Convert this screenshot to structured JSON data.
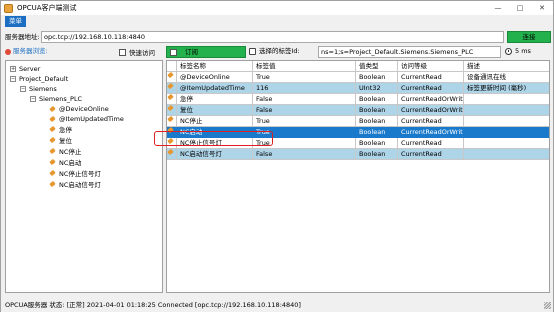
{
  "window": {
    "title": "OPCUA客户端测试",
    "minimize": "—",
    "maximize": "□",
    "close": "✕"
  },
  "menu": {
    "items": [
      "菜单"
    ]
  },
  "address": {
    "label": "服务器地址:",
    "value": "opc.tcp://192.168.10.118:4840",
    "connect_label": "连接"
  },
  "filter": {
    "label": "服务器浏览:",
    "quick_access": "快速访问",
    "subscribe_label": "订阅",
    "selected_tag_label": "选择的标签Id:",
    "selected_tag_value": "ns=1;s=Project_Default.Siemens.Siemens_PLC",
    "interval": "5 ms"
  },
  "tree": {
    "nodes": [
      {
        "label": "Server",
        "expander": "+"
      },
      {
        "label": "Project_Default",
        "expander": "−"
      },
      {
        "label": "Siemens",
        "expander": "−"
      },
      {
        "label": "Siemens_PLC",
        "expander": "−"
      },
      {
        "label": "@DeviceOnline"
      },
      {
        "label": "@ItemUpdatedTime"
      },
      {
        "label": "急停"
      },
      {
        "label": "复位"
      },
      {
        "label": "NC停止"
      },
      {
        "label": "NC启动"
      },
      {
        "label": "NC停止信号灯"
      },
      {
        "label": "NC启动信号灯"
      }
    ]
  },
  "grid": {
    "headers": [
      "标签名称",
      "标签值",
      "值类型",
      "访问等级",
      "描述"
    ],
    "rows": [
      [
        "@DeviceOnline",
        "True",
        "Boolean",
        "CurrentRead",
        "设备通讯在线"
      ],
      [
        "@ItemUpdatedTime",
        "116",
        "UInt32",
        "CurrentRead",
        "标签更新时间 (毫秒)"
      ],
      [
        "急停",
        "False",
        "Boolean",
        "CurrentReadOrWrite",
        ""
      ],
      [
        "复位",
        "False",
        "Boolean",
        "CurrentReadOrWrite",
        ""
      ],
      [
        "NC停止",
        "True",
        "Boolean",
        "CurrentRead",
        ""
      ],
      [
        "NC启动",
        "True",
        "Boolean",
        "CurrentReadOrWrite",
        ""
      ],
      [
        "NC停止信号灯",
        "True",
        "Boolean",
        "CurrentRead",
        ""
      ],
      [
        "NC启动信号灯",
        "False",
        "Boolean",
        "CurrentRead",
        ""
      ]
    ],
    "selected_row": 5
  },
  "status": {
    "text": "OPCUA服务器 状态:   [正常]   2021-04-01 01:18:25   Connected [opc.tcp://192.168.10.118:4840]"
  },
  "colors": {
    "accent": "#1979ca",
    "connect": "#22b14c",
    "row_alt": "#aed4e8",
    "highlight": "#e02020"
  }
}
